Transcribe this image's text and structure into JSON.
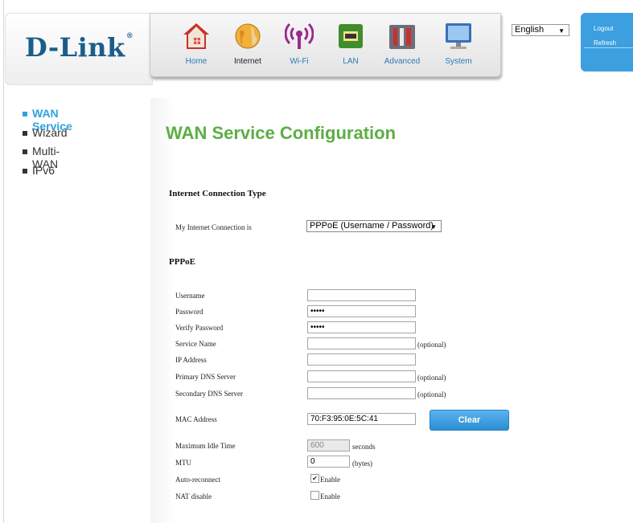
{
  "brand": {
    "logo_text": "D-Link",
    "logo_mark": "®"
  },
  "nav": {
    "items": [
      {
        "label": "Home",
        "icon": "home-icon"
      },
      {
        "label": "Internet",
        "icon": "globe-icon"
      },
      {
        "label": "Wi-Fi",
        "icon": "wifi-icon"
      },
      {
        "label": "LAN",
        "icon": "lan-icon"
      },
      {
        "label": "Advanced",
        "icon": "tools-icon"
      },
      {
        "label": "System",
        "icon": "monitor-icon"
      }
    ]
  },
  "language": {
    "selected": "English"
  },
  "actions": {
    "logout": "Logout",
    "refresh": "Refresh"
  },
  "sidebar": {
    "items": [
      {
        "label": "WAN Service"
      },
      {
        "label": "Wizard"
      },
      {
        "label": "Multi-WAN"
      },
      {
        "label": "IPv6"
      }
    ]
  },
  "page": {
    "title": "WAN Service Configuration"
  },
  "connection": {
    "section_title": "Internet Connection Type",
    "label": "My Internet Connection is",
    "selected": "PPPoE (Username / Password)"
  },
  "pppoe": {
    "section_title": "PPPoE",
    "username": {
      "label": "Username",
      "value": ""
    },
    "password": {
      "label": "Password",
      "value": "•••••"
    },
    "verify_password": {
      "label": "Verify Password",
      "value": "•••••"
    },
    "service_name": {
      "label": "Service Name",
      "value": "",
      "note": "(optional)"
    },
    "ip_address": {
      "label": "IP Address",
      "value": ""
    },
    "primary_dns": {
      "label": "Primary DNS Server",
      "value": "",
      "note": "(optional)"
    },
    "secondary_dns": {
      "label": "Secondary DNS Server",
      "value": "",
      "note": "(optional)"
    },
    "mac_address": {
      "label": "MAC Address",
      "value": "70:F3:95:0E:5C:41"
    },
    "clear_label": "Clear",
    "max_idle": {
      "label": "Maximum Idle Time",
      "value": "600",
      "unit": "seconds"
    },
    "mtu": {
      "label": "MTU",
      "value": "0",
      "unit": "(bytes)"
    },
    "auto_reconnect": {
      "label": "Auto-reconnect",
      "checkbox_label": "Enable",
      "checked": true,
      "mark": "✔"
    },
    "nat_disable": {
      "label": "NAT disable",
      "checkbox_label": "Enable",
      "checked": false
    }
  },
  "colors": {
    "accent_blue": "#2ea2df",
    "title_green": "#5cae43",
    "logo_blue": "#1a5d8a",
    "panel_blue": "#3c9fe0"
  }
}
